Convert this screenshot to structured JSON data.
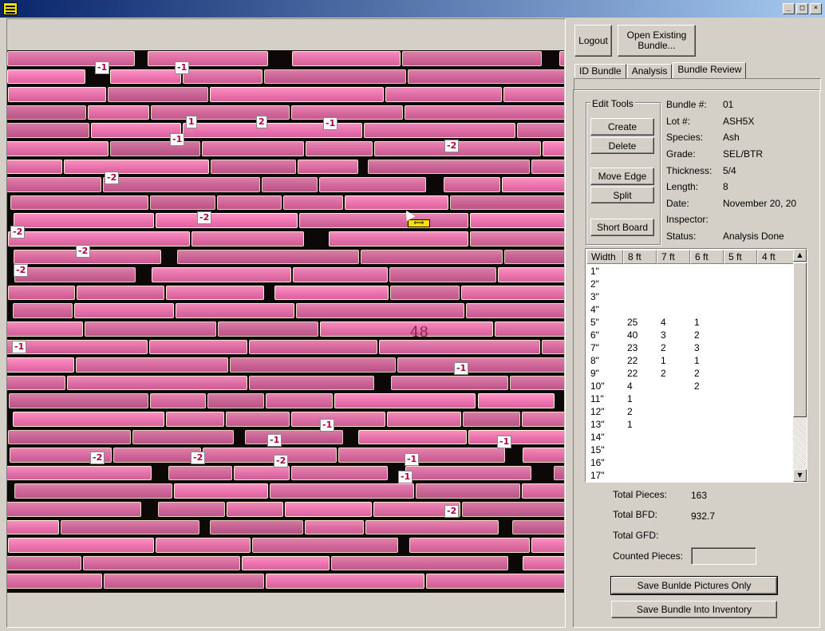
{
  "window": {
    "title": "",
    "buttons": [
      "_",
      "□",
      "×"
    ]
  },
  "toolbar": {
    "logout_label": "Logout",
    "open_label": "Open Existing Bundle..."
  },
  "tabs": [
    "ID Bundle",
    "Analysis",
    "Bundle Review"
  ],
  "active_tab": "Bundle Review",
  "edit_tools": {
    "title": "Edit Tools",
    "create": "Create",
    "delete": "Delete",
    "move_edge": "Move Edge",
    "split": "Split",
    "short_board": "Short Board"
  },
  "bundle_info": {
    "bundle_label": "Bundle #:",
    "bundle_value": "01",
    "lot_label": "Lot #:",
    "lot_value": "ASH5X",
    "species_label": "Species:",
    "species_value": "Ash",
    "grade_label": "Grade:",
    "grade_value": "SEL/BTR",
    "thickness_label": "Thickness:",
    "thickness_value": "5/4",
    "length_label": "Length:",
    "length_value": "8",
    "date_label": "Date:",
    "date_value": "November 20, 20",
    "inspector_label": "Inspector:",
    "inspector_value": "",
    "status_label": "Status:",
    "status_value": "Analysis Done"
  },
  "tally": {
    "columns": [
      "Width",
      "8 ft",
      "7 ft",
      "6 ft",
      "5 ft",
      "4 ft"
    ],
    "rows": [
      [
        "1\"",
        "",
        "",
        "",
        "",
        ""
      ],
      [
        "2\"",
        "",
        "",
        "",
        "",
        ""
      ],
      [
        "3\"",
        "",
        "",
        "",
        "",
        ""
      ],
      [
        "4\"",
        "",
        "",
        "",
        "",
        ""
      ],
      [
        "5\"",
        "25",
        "4",
        "1",
        "",
        ""
      ],
      [
        "6\"",
        "40",
        "3",
        "2",
        "",
        ""
      ],
      [
        "7\"",
        "23",
        "2",
        "3",
        "",
        ""
      ],
      [
        "8\"",
        "22",
        "1",
        "1",
        "",
        ""
      ],
      [
        "9\"",
        "22",
        "2",
        "2",
        "",
        ""
      ],
      [
        "10\"",
        "4",
        "",
        "2",
        "",
        ""
      ],
      [
        "11\"",
        "1",
        "",
        "",
        "",
        ""
      ],
      [
        "12\"",
        "2",
        "",
        "",
        "",
        ""
      ],
      [
        "13\"",
        "1",
        "",
        "",
        "",
        ""
      ],
      [
        "14\"",
        "",
        "",
        "",
        "",
        ""
      ],
      [
        "15\"",
        "",
        "",
        "",
        "",
        ""
      ],
      [
        "16\"",
        "",
        "",
        "",
        "",
        ""
      ],
      [
        "17\"",
        "",
        "",
        "",
        "",
        ""
      ]
    ]
  },
  "totals": {
    "pieces_label": "Total Pieces:",
    "pieces_value": "163",
    "bfd_label": "Total BFD:",
    "bfd_value": "932.7",
    "gfd_label": "Total GFD:",
    "gfd_value": "",
    "counted_label": "Counted Pieces:",
    "counted_value": ""
  },
  "actions": {
    "save_pictures": "Save Bunlde Pictures Only",
    "save_inventory": "Save Bundle Into Inventory"
  },
  "photo": {
    "board_tags": [
      "-1",
      "-1",
      "1",
      "2",
      "-1",
      "-1",
      "-2",
      "-2",
      "-2",
      "-2",
      "-2",
      "-2",
      "-1",
      "-1",
      "-1",
      "-1",
      "-1",
      "-2",
      "-2",
      "-2",
      "-1",
      "-1",
      "-2"
    ],
    "handwritten_mark": "48"
  },
  "colors": {
    "board": "#d96aa0",
    "tag_text": "#b0003a",
    "handle": "#f6e000",
    "titlebar": "#0a246a"
  }
}
